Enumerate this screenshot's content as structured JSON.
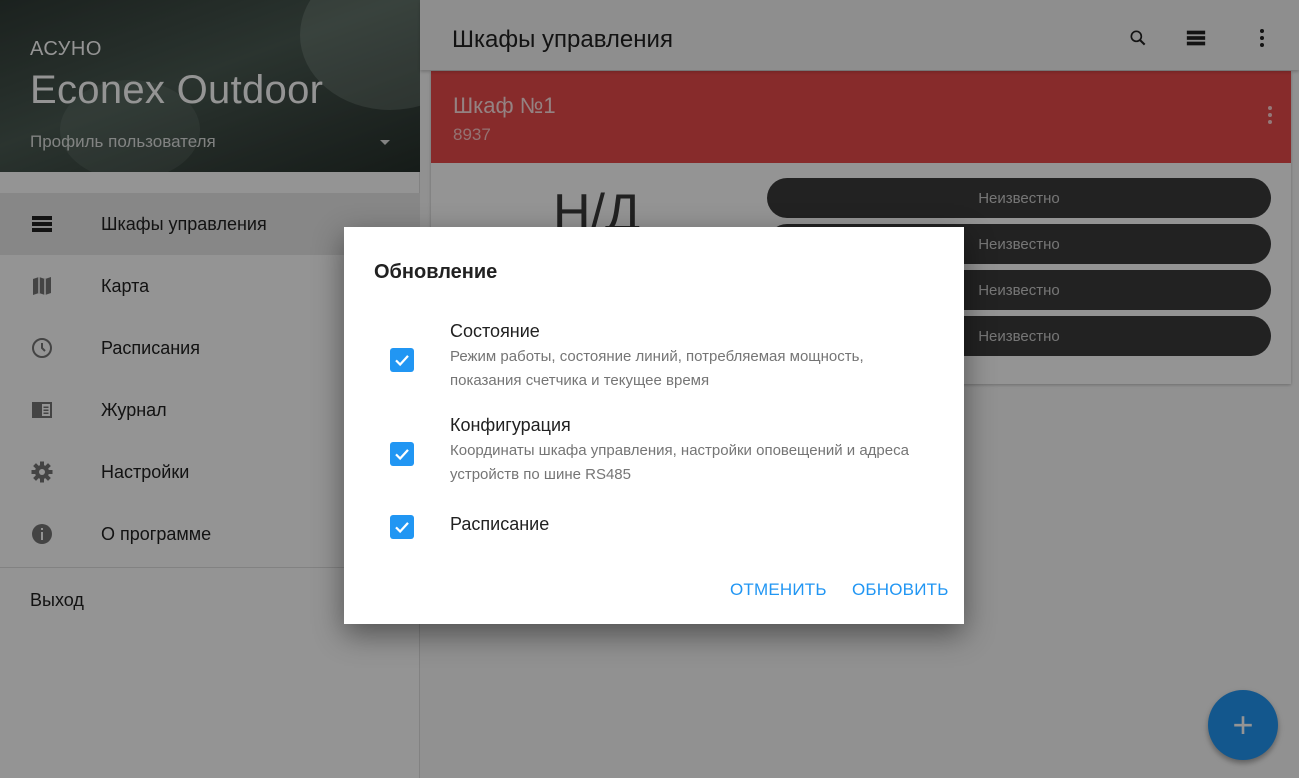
{
  "sidebar": {
    "brand_small": "АСУНО",
    "brand_big": "Econex Outdoor",
    "profile_label": "Профиль пользователя",
    "items": [
      {
        "label": "Шкафы управления",
        "icon": "cabinet-icon",
        "active": true
      },
      {
        "label": "Карта",
        "icon": "map-icon"
      },
      {
        "label": "Расписания",
        "icon": "clock-icon"
      },
      {
        "label": "Журнал",
        "icon": "journal-icon"
      },
      {
        "label": "Настройки",
        "icon": "gear-icon"
      },
      {
        "label": "О программе",
        "icon": "info-icon"
      }
    ],
    "logout_label": "Выход"
  },
  "topbar": {
    "title": "Шкафы управления",
    "actions": [
      "search-icon",
      "view-list-icon",
      "more-vert-icon"
    ]
  },
  "cabinet_card": {
    "title": "Шкаф №1",
    "subtitle": "8937",
    "value": "Н/Д",
    "header_color": "#e84a4a",
    "statuses": [
      "Неизвестно",
      "Неизвестно",
      "Неизвестно",
      "Неизвестно"
    ]
  },
  "fab": {
    "label": "+",
    "color": "#2196f3"
  },
  "dialog": {
    "title": "Обновление",
    "options": [
      {
        "title": "Состояние",
        "description": "Режим работы, состояние линий, потребляемая мощность, показания счетчика и текущее время",
        "checked": true
      },
      {
        "title": "Конфигурация",
        "description": "Координаты шкафа управления, настройки оповещений и адреса устройств по шине RS485",
        "checked": true
      },
      {
        "title": "Расписание",
        "description": "",
        "checked": true
      }
    ],
    "cancel_label": "Отменить",
    "confirm_label": "Обновить",
    "accent_color": "#2196f3"
  }
}
